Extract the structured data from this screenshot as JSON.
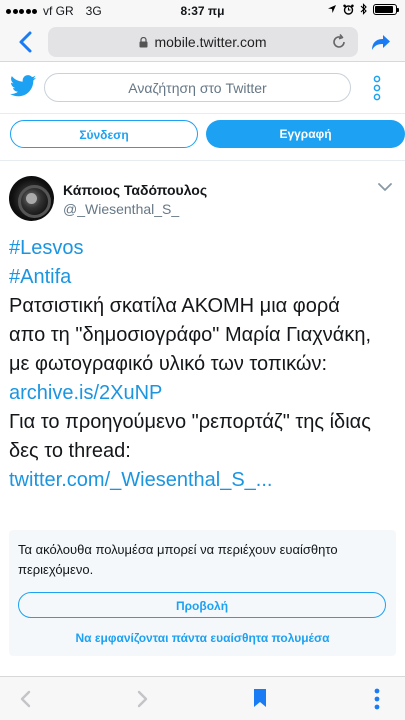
{
  "status_bar": {
    "carrier": "vf GR",
    "network": "3G",
    "time": "8:37 πμ",
    "battery_level": 0.9
  },
  "browser": {
    "url": "mobile.twitter.com",
    "icons": [
      "back-icon",
      "lock-icon",
      "reload-icon",
      "share-icon"
    ]
  },
  "header": {
    "search_placeholder": "Αναζήτηση στο Twitter",
    "logo": "twitter-bird-icon"
  },
  "auth": {
    "login_label": "Σύνδεση",
    "signup_label": "Εγγραφή"
  },
  "tweet": {
    "author_name": "Κάποιος Ταδόπουλος",
    "author_handle": "@_Wiesenthal_S_",
    "lines": {
      "hashtag1": "#Lesvos",
      "hashtag2": "#Antifa",
      "text1": "Ρατσιστική σκατίλα ΑΚΟΜΗ μια φορά",
      "text2": "απο τη \"δημοσιογράφο\" Μαρία Γιαχνάκη,",
      "text3": "με φωτογραφικό υλικό των τοπικών:",
      "link1": "archive.is/2XuNP",
      "text4": "Για το προηγούμενο \"ρεπορτάζ\" της ίδιας",
      "text5": "δες το thread:",
      "link2": "twitter.com/_Wiesenthal_S_..."
    }
  },
  "sensitive_media": {
    "warning": "Τα ακόλουθα πολυμέσα μπορεί να περιέχουν ευαίσθητο περιεχόμενο.",
    "view_label": "Προβολή",
    "always_show_label": "Να εμφανίζονται πάντα ευαίσθητα πολυμέσα"
  },
  "colors": {
    "twitter_blue": "#1da1f2",
    "link_blue": "#1b95e0",
    "ios_blue": "#1a7cf5"
  }
}
